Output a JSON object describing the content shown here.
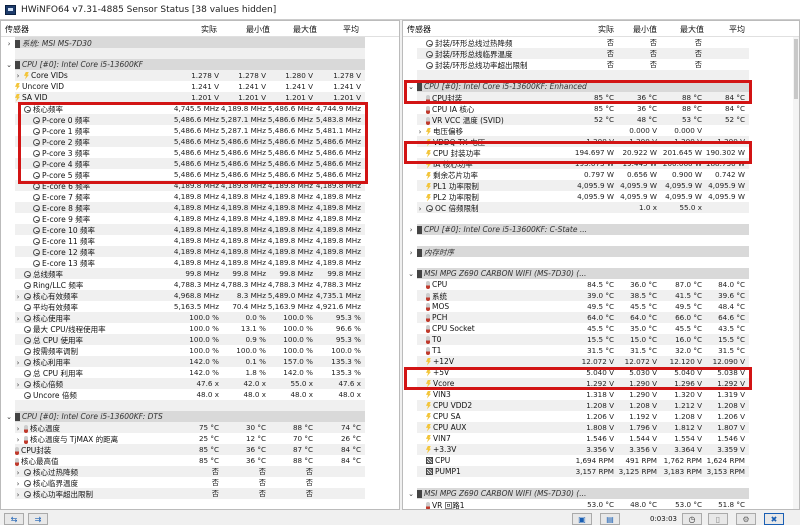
{
  "window": {
    "title": "HWiNFO64 v7.31-4885 Sensor Status [38 values hidden]"
  },
  "columns": {
    "sensor": "传感器",
    "current": "实际",
    "min": "最小值",
    "max": "最大值",
    "avg": "平均"
  },
  "left_rows": [
    {
      "t": "group",
      "chev": ">",
      "icon": "chip",
      "name": "系统: MSI MS-7D30"
    },
    {
      "t": "blank"
    },
    {
      "t": "group",
      "chev": "v",
      "icon": "chip",
      "name": "CPU [#0]: Intel Core i5-13600KF"
    },
    {
      "chev": ">",
      "icon": "bolt",
      "ind": 1,
      "name": "Core VIDs",
      "v": [
        "1.278 V",
        "1.278 V",
        "1.280 V",
        "1.278 V"
      ]
    },
    {
      "icon": "bolt",
      "name": "Uncore VID",
      "v": [
        "1.241 V",
        "1.241 V",
        "1.241 V",
        "1.241 V"
      ]
    },
    {
      "icon": "bolt",
      "name": "SA VID",
      "v": [
        "1.201 V",
        "1.201 V",
        "1.201 V",
        "1.201 V"
      ]
    },
    {
      "icon": "clock",
      "ind": 1,
      "name": "核心频率",
      "v": [
        "4,745.5 MHz",
        "4,189.8 MHz",
        "5,486.6 MHz",
        "4,744.9 MHz"
      ]
    },
    {
      "icon": "clock",
      "ind": 2,
      "name": "P-core 0 频率",
      "v": [
        "5,486.6 MHz",
        "5,287.1 MHz",
        "5,486.6 MHz",
        "5,483.8 MHz"
      ]
    },
    {
      "icon": "clock",
      "ind": 2,
      "name": "P-core 1 频率",
      "v": [
        "5,486.6 MHz",
        "5,287.1 MHz",
        "5,486.6 MHz",
        "5,481.1 MHz"
      ]
    },
    {
      "icon": "clock",
      "ind": 2,
      "name": "P-core 2 频率",
      "v": [
        "5,486.6 MHz",
        "5,486.6 MHz",
        "5,486.6 MHz",
        "5,486.6 MHz"
      ]
    },
    {
      "icon": "clock",
      "ind": 2,
      "name": "P-core 3 频率",
      "v": [
        "5,486.6 MHz",
        "5,486.6 MHz",
        "5,486.6 MHz",
        "5,486.6 MHz"
      ]
    },
    {
      "icon": "clock",
      "ind": 2,
      "name": "P-core 4 频率",
      "v": [
        "5,486.6 MHz",
        "5,486.6 MHz",
        "5,486.6 MHz",
        "5,486.6 MHz"
      ]
    },
    {
      "icon": "clock",
      "ind": 2,
      "name": "P-core 5 频率",
      "v": [
        "5,486.6 MHz",
        "5,486.6 MHz",
        "5,486.6 MHz",
        "5,486.6 MHz"
      ]
    },
    {
      "icon": "clock",
      "ind": 2,
      "name": "E-core 6 频率",
      "v": [
        "4,189.8 MHz",
        "4,189.8 MHz",
        "4,189.8 MHz",
        "4,189.8 MHz"
      ]
    },
    {
      "icon": "clock",
      "ind": 2,
      "name": "E-core 7 频率",
      "v": [
        "4,189.8 MHz",
        "4,189.8 MHz",
        "4,189.8 MHz",
        "4,189.8 MHz"
      ]
    },
    {
      "icon": "clock",
      "ind": 2,
      "name": "E-core 8 频率",
      "v": [
        "4,189.8 MHz",
        "4,189.8 MHz",
        "4,189.8 MHz",
        "4,189.8 MHz"
      ]
    },
    {
      "icon": "clock",
      "ind": 2,
      "name": "E-core 9 频率",
      "v": [
        "4,189.8 MHz",
        "4,189.8 MHz",
        "4,189.8 MHz",
        "4,189.8 MHz"
      ]
    },
    {
      "icon": "clock",
      "ind": 2,
      "name": "E-core 10 频率",
      "v": [
        "4,189.8 MHz",
        "4,189.8 MHz",
        "4,189.8 MHz",
        "4,189.8 MHz"
      ]
    },
    {
      "icon": "clock",
      "ind": 2,
      "name": "E-core 11 频率",
      "v": [
        "4,189.8 MHz",
        "4,189.8 MHz",
        "4,189.8 MHz",
        "4,189.8 MHz"
      ]
    },
    {
      "icon": "clock",
      "ind": 2,
      "name": "E-core 12 频率",
      "v": [
        "4,189.8 MHz",
        "4,189.8 MHz",
        "4,189.8 MHz",
        "4,189.8 MHz"
      ]
    },
    {
      "icon": "clock",
      "ind": 2,
      "name": "E-core 13 频率",
      "v": [
        "4,189.8 MHz",
        "4,189.8 MHz",
        "4,189.8 MHz",
        "4,189.8 MHz"
      ]
    },
    {
      "icon": "clock",
      "ind": 1,
      "name": "总线频率",
      "v": [
        "99.8 MHz",
        "99.8 MHz",
        "99.8 MHz",
        "99.8 MHz"
      ]
    },
    {
      "icon": "clock",
      "ind": 1,
      "name": "Ring/LLC 频率",
      "v": [
        "4,788.3 MHz",
        "4,788.3 MHz",
        "4,788.3 MHz",
        "4,788.3 MHz"
      ]
    },
    {
      "chev": ">",
      "icon": "clock",
      "ind": 1,
      "name": "核心有效频率",
      "v": [
        "4,968.8 MHz",
        "8.3 MHz",
        "5,489.0 MHz",
        "4,735.1 MHz"
      ]
    },
    {
      "icon": "clock",
      "ind": 1,
      "name": "平均有效频率",
      "v": [
        "5,163.5 MHz",
        "70.4 MHz",
        "5,163.9 MHz",
        "4,921.6 MHz"
      ]
    },
    {
      "chev": ">",
      "icon": "clock",
      "ind": 1,
      "name": "核心使用率",
      "v": [
        "100.0 %",
        "0.0 %",
        "100.0 %",
        "95.3 %"
      ]
    },
    {
      "icon": "clock",
      "ind": 1,
      "name": "最大 CPU/线程使用率",
      "v": [
        "100.0 %",
        "13.1 %",
        "100.0 %",
        "96.6 %"
      ]
    },
    {
      "icon": "clock",
      "ind": 1,
      "name": "总 CPU 使用率",
      "v": [
        "100.0 %",
        "0.9 %",
        "100.0 %",
        "95.3 %"
      ]
    },
    {
      "icon": "clock",
      "ind": 1,
      "name": "按需频率调制",
      "v": [
        "100.0 %",
        "100.0 %",
        "100.0 %",
        "100.0 %"
      ]
    },
    {
      "chev": ">",
      "icon": "clock",
      "ind": 1,
      "name": "核心利用率",
      "v": [
        "142.0 %",
        "0.1 %",
        "157.0 %",
        "135.3 %"
      ]
    },
    {
      "icon": "clock",
      "ind": 1,
      "name": "总 CPU 利用率",
      "v": [
        "142.0 %",
        "1.8 %",
        "142.0 %",
        "135.3 %"
      ]
    },
    {
      "chev": ">",
      "icon": "clock",
      "ind": 1,
      "name": "核心倍频",
      "v": [
        "47.6 x",
        "42.0 x",
        "55.0 x",
        "47.6 x"
      ]
    },
    {
      "icon": "clock",
      "ind": 1,
      "name": "Uncore 倍频",
      "v": [
        "48.0 x",
        "48.0 x",
        "48.0 x",
        "48.0 x"
      ]
    },
    {
      "t": "blank"
    },
    {
      "t": "group",
      "chev": "v",
      "icon": "chip",
      "name": "CPU [#0]: Intel Core i5-13600KF: DTS"
    },
    {
      "chev": ">",
      "icon": "therm",
      "ind": 1,
      "name": "核心温度",
      "v": [
        "75 °C",
        "30 °C",
        "88 °C",
        "74 °C"
      ]
    },
    {
      "chev": ">",
      "icon": "therm",
      "ind": 1,
      "name": "核心温度与 TjMAX 的距离",
      "v": [
        "25 °C",
        "12 °C",
        "70 °C",
        "26 °C"
      ]
    },
    {
      "icon": "therm",
      "name": "CPU封装",
      "v": [
        "85 °C",
        "36 °C",
        "87 °C",
        "84 °C"
      ]
    },
    {
      "icon": "therm",
      "name": "核心最高值",
      "v": [
        "85 °C",
        "36 °C",
        "88 °C",
        "84 °C"
      ]
    },
    {
      "chev": ">",
      "icon": "clock",
      "ind": 1,
      "name": "核心过热降频",
      "v": [
        "否",
        "否",
        "否",
        ""
      ]
    },
    {
      "chev": ">",
      "icon": "clock",
      "ind": 1,
      "name": "核心临界温度",
      "v": [
        "否",
        "否",
        "否",
        ""
      ]
    },
    {
      "chev": ">",
      "icon": "clock",
      "ind": 1,
      "name": "核心功率超出限制",
      "v": [
        "否",
        "否",
        "否",
        ""
      ]
    }
  ],
  "right_rows": [
    {
      "icon": "clock",
      "ind": 1,
      "name": "封装/环形总线过热降频",
      "v": [
        "否",
        "否",
        "否",
        ""
      ]
    },
    {
      "icon": "clock",
      "ind": 1,
      "name": "封装/环形总线临界温度",
      "v": [
        "否",
        "否",
        "否",
        ""
      ]
    },
    {
      "icon": "clock",
      "ind": 1,
      "name": "封装/环形总线功率超出限制",
      "v": [
        "否",
        "否",
        "否",
        ""
      ]
    },
    {
      "t": "blank"
    },
    {
      "t": "group",
      "chev": "v",
      "icon": "chip",
      "name": "CPU [#0]: Intel Core i5-13600KF: Enhanced"
    },
    {
      "icon": "therm",
      "ind": 1,
      "name": "CPU封装",
      "v": [
        "85 °C",
        "36 °C",
        "88 °C",
        "84 °C"
      ]
    },
    {
      "icon": "therm",
      "ind": 1,
      "name": "CPU IA 核心",
      "v": [
        "85 °C",
        "36 °C",
        "88 °C",
        "84 °C"
      ]
    },
    {
      "icon": "therm",
      "ind": 1,
      "name": "VR VCC 温度 (SVID)",
      "v": [
        "52 °C",
        "48 °C",
        "53 °C",
        "52 °C"
      ]
    },
    {
      "chev": ">",
      "icon": "bolt",
      "ind": 1,
      "name": "电压偏移",
      "v": [
        "",
        "0.000 V",
        "0.000 V",
        ""
      ]
    },
    {
      "icon": "bolt",
      "ind": 1,
      "name": "VDDQ TX 电压",
      "v": [
        "1.200 V",
        "1.200 V",
        "1.200 V",
        "1.200 V"
      ]
    },
    {
      "icon": "bolt",
      "ind": 1,
      "name": "CPU 封装功率",
      "v": [
        "194.697 W",
        "20.922 W",
        "201.645 W",
        "190.302 W"
      ]
    },
    {
      "icon": "bolt",
      "ind": 1,
      "name": "IA 核心功率",
      "v": [
        "193.073 W",
        "19.445 W",
        "200.060 W",
        "188.736 W"
      ]
    },
    {
      "icon": "bolt",
      "ind": 1,
      "name": "剩余芯片功率",
      "v": [
        "0.797 W",
        "0.656 W",
        "0.900 W",
        "0.742 W"
      ]
    },
    {
      "icon": "bolt",
      "ind": 1,
      "name": "PL1 功率限制",
      "v": [
        "4,095.9 W",
        "4,095.9 W",
        "4,095.9 W",
        "4,095.9 W"
      ]
    },
    {
      "icon": "bolt",
      "ind": 1,
      "name": "PL2 功率限制",
      "v": [
        "4,095.9 W",
        "4,095.9 W",
        "4,095.9 W",
        "4,095.9 W"
      ]
    },
    {
      "chev": ">",
      "icon": "clock",
      "ind": 1,
      "name": "OC 倍频限制",
      "v": [
        "",
        "1.0 x",
        "55.0 x",
        ""
      ]
    },
    {
      "t": "blank"
    },
    {
      "t": "group",
      "chev": ">",
      "icon": "chip",
      "name": "CPU [#0]: Intel Core i5-13600KF: C-State ..."
    },
    {
      "t": "blank"
    },
    {
      "t": "group",
      "chev": ">",
      "icon": "chip",
      "name": "内存时序"
    },
    {
      "t": "blank"
    },
    {
      "t": "group",
      "chev": "v",
      "icon": "chip",
      "name": "MSI MPG Z690 CARBON WIFI (MS-7D30) (..."
    },
    {
      "icon": "therm",
      "ind": 1,
      "name": "CPU",
      "v": [
        "84.5 °C",
        "36.0 °C",
        "87.0 °C",
        "84.0 °C"
      ]
    },
    {
      "icon": "therm",
      "ind": 1,
      "name": "系统",
      "v": [
        "39.0 °C",
        "38.5 °C",
        "41.5 °C",
        "39.6 °C"
      ]
    },
    {
      "icon": "therm",
      "ind": 1,
      "name": "MOS",
      "v": [
        "49.5 °C",
        "45.5 °C",
        "49.5 °C",
        "48.4 °C"
      ]
    },
    {
      "icon": "therm",
      "ind": 1,
      "name": "PCH",
      "v": [
        "64.0 °C",
        "64.0 °C",
        "66.0 °C",
        "64.6 °C"
      ]
    },
    {
      "icon": "therm",
      "ind": 1,
      "name": "CPU Socket",
      "v": [
        "45.5 °C",
        "35.0 °C",
        "45.5 °C",
        "43.5 °C"
      ]
    },
    {
      "icon": "therm",
      "ind": 1,
      "name": "T0",
      "v": [
        "15.5 °C",
        "15.0 °C",
        "16.0 °C",
        "15.5 °C"
      ]
    },
    {
      "icon": "therm",
      "ind": 1,
      "name": "T1",
      "v": [
        "31.5 °C",
        "31.5 °C",
        "32.0 °C",
        "31.5 °C"
      ]
    },
    {
      "icon": "bolt",
      "ind": 1,
      "name": "+12V",
      "v": [
        "12.072 V",
        "12.072 V",
        "12.120 V",
        "12.090 V"
      ]
    },
    {
      "icon": "bolt",
      "ind": 1,
      "name": "+5V",
      "v": [
        "5.040 V",
        "5.030 V",
        "5.040 V",
        "5.038 V"
      ]
    },
    {
      "icon": "bolt",
      "ind": 1,
      "name": "Vcore",
      "v": [
        "1.292 V",
        "1.290 V",
        "1.296 V",
        "1.292 V"
      ]
    },
    {
      "icon": "bolt",
      "ind": 1,
      "name": "VIN3",
      "v": [
        "1.318 V",
        "1.290 V",
        "1.320 V",
        "1.319 V"
      ]
    },
    {
      "icon": "bolt",
      "ind": 1,
      "name": "CPU VDD2",
      "v": [
        "1.208 V",
        "1.208 V",
        "1.212 V",
        "1.208 V"
      ]
    },
    {
      "icon": "bolt",
      "ind": 1,
      "name": "CPU SA",
      "v": [
        "1.206 V",
        "1.192 V",
        "1.208 V",
        "1.206 V"
      ]
    },
    {
      "icon": "bolt",
      "ind": 1,
      "name": "CPU AUX",
      "v": [
        "1.808 V",
        "1.796 V",
        "1.812 V",
        "1.807 V"
      ]
    },
    {
      "icon": "bolt",
      "ind": 1,
      "name": "VIN7",
      "v": [
        "1.546 V",
        "1.544 V",
        "1.554 V",
        "1.546 V"
      ]
    },
    {
      "icon": "bolt",
      "ind": 1,
      "name": "+3.3V",
      "v": [
        "3.356 V",
        "3.356 V",
        "3.364 V",
        "3.359 V"
      ]
    },
    {
      "icon": "fan",
      "ind": 1,
      "name": "CPU",
      "v": [
        "1,694 RPM",
        "491 RPM",
        "1,762 RPM",
        "1,624 RPM"
      ]
    },
    {
      "icon": "fan",
      "ind": 1,
      "name": "PUMP1",
      "v": [
        "3,157 RPM",
        "3,125 RPM",
        "3,183 RPM",
        "3,153 RPM"
      ]
    },
    {
      "t": "blank"
    },
    {
      "t": "group",
      "chev": "v",
      "icon": "chip",
      "name": "MSI MPG Z690 CARBON WIFI (MS-7D30) (..."
    },
    {
      "icon": "therm",
      "ind": 1,
      "name": "VR 回路1",
      "v": [
        "53.0 °C",
        "48.0 °C",
        "53.0 °C",
        "51.8 °C"
      ]
    }
  ],
  "footer": {
    "timer": "0:03:03",
    "nav_prev": "⇆",
    "nav_next": "⇉"
  },
  "colors": {
    "highlight": "#d21414",
    "group_bg": "#d9d9d9"
  }
}
